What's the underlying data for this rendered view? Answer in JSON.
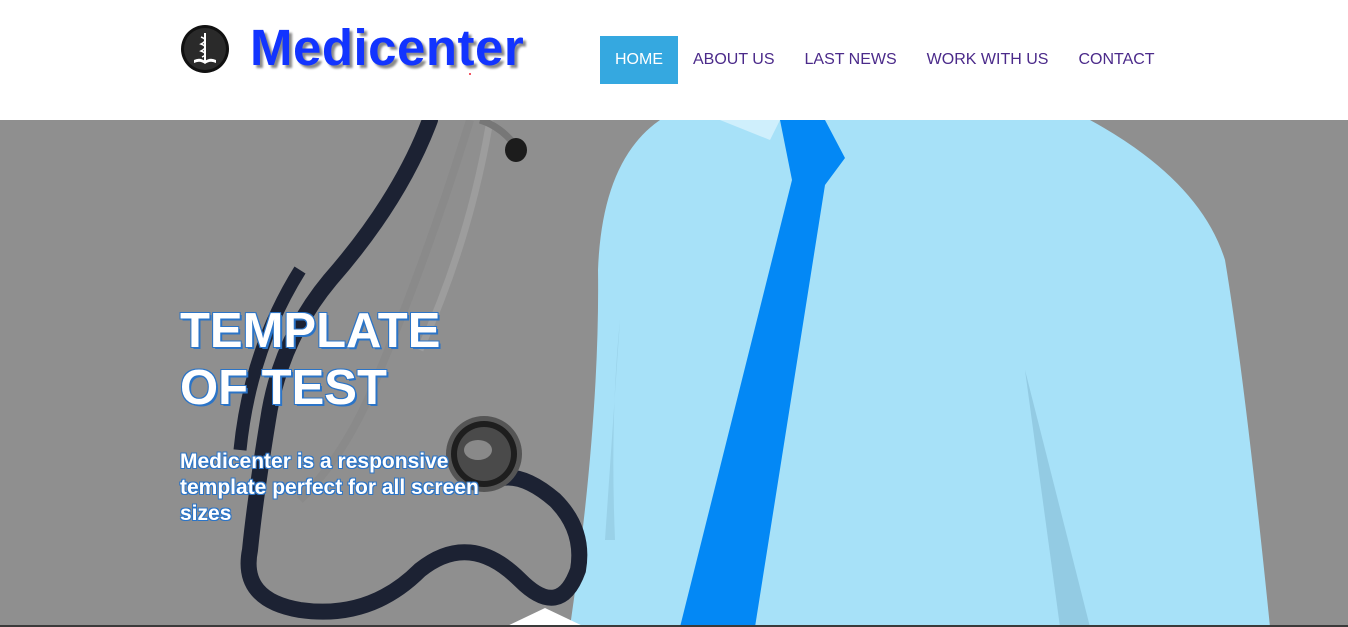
{
  "brand": {
    "name": "Medicenter",
    "accent_color": "#1234ff",
    "logo_icon": "caduceus-book-icon"
  },
  "nav": {
    "items": [
      {
        "label": "HOME",
        "active": true
      },
      {
        "label": "ABOUT US",
        "active": false
      },
      {
        "label": "LAST NEWS",
        "active": false
      },
      {
        "label": "WORK WITH US",
        "active": false
      },
      {
        "label": "CONTACT",
        "active": false
      }
    ],
    "active_color": "#35a8e0",
    "text_color": "#4b2a8a"
  },
  "hero": {
    "title": "TEMPLATE OF TEST",
    "subtitle": "Medicenter is a responsive template perfect for all screen sizes",
    "background_color": "#8f8f8f",
    "illustration": "doctor-shirt-tie-stethoscope"
  }
}
